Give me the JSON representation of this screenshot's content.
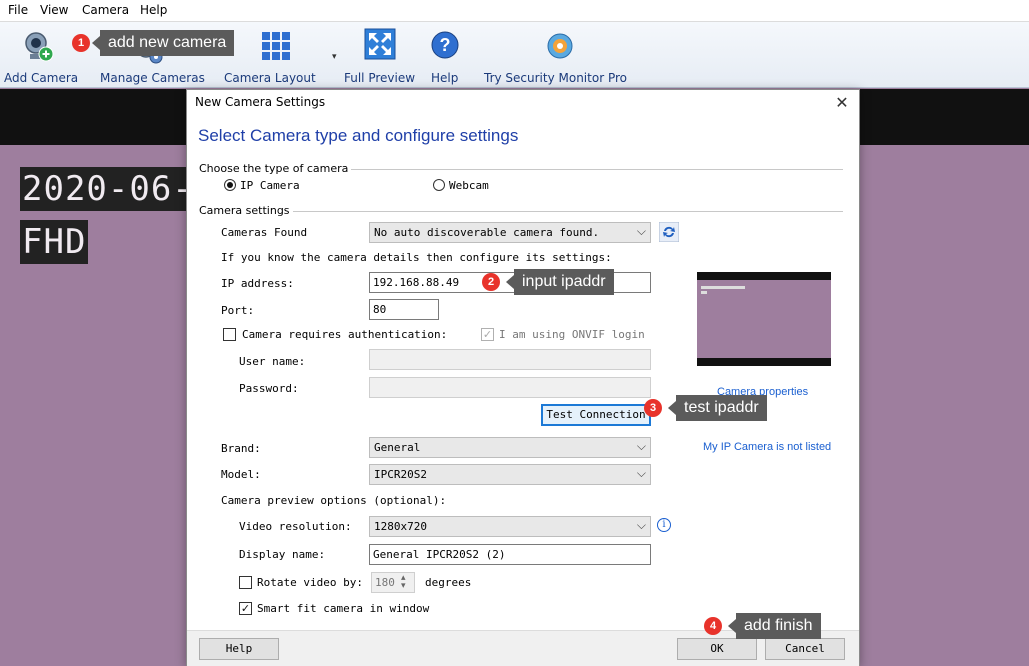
{
  "menu": {
    "file": "File",
    "view": "View",
    "camera": "Camera",
    "help": "Help"
  },
  "toolbar": {
    "add_camera": "Add Camera",
    "manage_cameras": "Manage Cameras",
    "camera_layout": "Camera Layout",
    "full_preview": "Full Preview",
    "help": "Help",
    "try_pro": "Try Security Monitor Pro"
  },
  "video": {
    "osd_date": "2020-06-",
    "osd_quality": "FHD"
  },
  "dialog": {
    "title": "New Camera Settings",
    "close": "✕",
    "heading": "Select Camera type and configure settings",
    "type_group": "Choose the type of camera",
    "ip_camera": "IP Camera",
    "webcam": "Webcam",
    "settings_group": "Camera settings",
    "cameras_found_label": "Cameras Found",
    "cameras_found_value": "No auto discoverable camera found.",
    "know_details": "If you know the camera details then configure its settings:",
    "ip_label": "IP address:",
    "ip_value": "192.168.88.49",
    "port_label": "Port:",
    "port_value": "80",
    "requires_auth": "Camera requires authentication:",
    "onvif_login": "I am using ONVIF login",
    "username_label": "User name:",
    "password_label": "Password:",
    "test_connection": "Test Connection",
    "camera_properties": "Camera properties",
    "not_listed": "My IP Camera is not listed",
    "brand_label": "Brand:",
    "brand_value": "General",
    "model_label": "Model:",
    "model_value": "IPCR20S2",
    "preview_options": "Camera preview options (optional):",
    "resolution_label": "Video resolution:",
    "resolution_value": "1280x720",
    "display_name_label": "Display name:",
    "display_name_value": "General IPCR20S2 (2)",
    "rotate_label": "Rotate video by:",
    "rotate_value": "180",
    "degrees": "degrees",
    "smart_fit": "Smart fit camera in window",
    "help_button": "Help",
    "ok_button": "OK",
    "cancel_button": "Cancel"
  },
  "callouts": [
    {
      "num": "1",
      "text": "add new camera"
    },
    {
      "num": "2",
      "text": "input ipaddr"
    },
    {
      "num": "3",
      "text": "test ipaddr"
    },
    {
      "num": "4",
      "text": "add finish"
    }
  ],
  "colors": {
    "accent_blue": "#1f3fa8",
    "link_blue": "#1a5fd0",
    "callout_red": "#e8332b",
    "callout_gray": "#5b5b5b",
    "video_bg": "#9e7e9e"
  }
}
